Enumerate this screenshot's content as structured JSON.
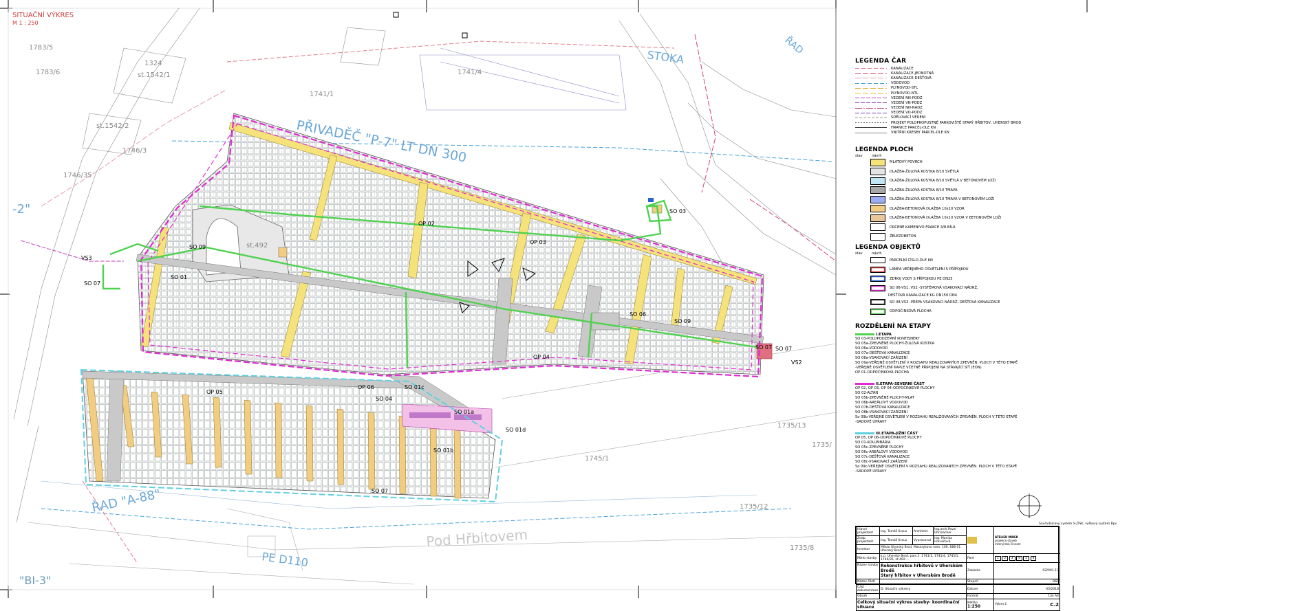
{
  "drawing": {
    "title": "SITUAČNÍ VÝKRES",
    "scale": "M 1 : 250"
  },
  "map_labels": {
    "privadec": "PŘIVADĚČ \"P-7\" LT DN 300",
    "pod_hrbitovem": "Pod Hřbitovem",
    "rad_a88": "ŘAD \"A-88\"",
    "stoka_bi3": "\"BI-3\"",
    "stoka": "STOKA",
    "rad": "ŘAD",
    "pe_label": "PE D110",
    "quote2": "-2\"",
    "parcels": [
      "1783/5",
      "1783/6",
      "st.1542/1",
      "st.1542/2",
      "1746/35",
      "1741/1",
      "1741/4",
      "st.492",
      "1745/1",
      "1735/13",
      "1735/12",
      "1735/8",
      "1735/",
      "1746/3",
      "1324"
    ],
    "objects": [
      "SO 09",
      "SO 01",
      "SO 07",
      "VS3",
      "OP 02",
      "OP 03",
      "SO 03",
      "SO 06",
      "SO 09",
      "SO 07",
      "SO 07",
      "VS2",
      "OP 04",
      "OP 05",
      "OP 06",
      "SO 04",
      "SO 01c",
      "SO 01a",
      "SO 01d",
      "SO 01b",
      "SO 07"
    ]
  },
  "legend_lines": {
    "title": "LEGENDA ČAR",
    "items": [
      {
        "label": "KANALIZACE",
        "color": "#e07a8a",
        "dash": "6,3"
      },
      {
        "label": "KANALIZACE-JEDNOTNÁ",
        "color": "#d2466a",
        "dash": "8,3"
      },
      {
        "label": "KANALIZACE-DEŠŤOVÁ",
        "color": "#e59aa8",
        "dash": "8,3"
      },
      {
        "label": "VODOVOD",
        "color": "#4aa3d8",
        "dash": "6,3"
      },
      {
        "label": "PLYNOVOD-STL",
        "color": "#e3a520",
        "dash": "8,3"
      },
      {
        "label": "PLYNOVOD-NTL",
        "color": "#d8c030",
        "dash": "8,3"
      },
      {
        "label": "VEDENÍ NN-PODZ",
        "color": "#c040c0",
        "dash": "6,2"
      },
      {
        "label": "VEDENÍ VN-PODZ",
        "color": "#8a3aa8",
        "dash": "6,2"
      },
      {
        "label": "VEDENÍ NN-NADZ",
        "color": "#b0306a",
        "dash": "10,2,2,2"
      },
      {
        "label": "VEDENÍ VO-PODZ",
        "color": "#7040c0",
        "dash": "6,2"
      },
      {
        "label": "SDĚLOVACÍ VEDENÍ",
        "color": "#909090",
        "dash": "4,2"
      },
      {
        "label": "PROJEKT POLOPROPUSTNÉ PARKOVIŠTĚ STARÝ HŘBITOV, UHERSKÝ BROD",
        "color": "#606060",
        "dash": "2,2"
      },
      {
        "label": "HRANICE PARCEL-DLE KN",
        "color": "#404040",
        "dash": "0"
      },
      {
        "label": "VNITŘNÍ KRESBY PARCEL-DLE KN",
        "color": "#808080",
        "dash": "0"
      }
    ]
  },
  "legend_areas": {
    "title": "LEGENDA PLOCH",
    "col_stav": "stav",
    "col_navrh": "návrh",
    "items": [
      {
        "label": "MLATOVÝ POVRCH",
        "color": "#f6e27a"
      },
      {
        "label": "DLAŽBA-ŽULOVÁ KOSTKA 8/10 SVĚTLÁ",
        "color": "#e4e4e4"
      },
      {
        "label": "DLAŽBA-ŽULOVÁ KOSTKA 8/10 SVĚTLÁ V BETONOVÉM LOŽI",
        "color": "#bfe6f2"
      },
      {
        "label": "DLAŽBA-ŽULOVÁ KOSTKA 8/10 TMAVÁ",
        "color": "#a8a8a8"
      },
      {
        "label": "DLAŽBA-ŽULOVÁ KOSTKA 8/10 TMAVÁ V BETONOVÉM LOŽI",
        "color": "#9cacf0"
      },
      {
        "label": "DLAŽBA-BETONOVÁ DLAŽBA 10x10 VZOR",
        "color": "#f2cc80"
      },
      {
        "label": "DLAŽBA-BETONOVÁ DLAŽBA 10x10 VZOR V BETONOVÉM LOŽI",
        "color": "#e9c79a"
      },
      {
        "label": "DRCENÉ KAMENIVO FRAKCE 4/8-BÍLÁ",
        "color": "#ffffff"
      },
      {
        "label": "ŽELEZOBETON",
        "color": "#ffffff"
      }
    ]
  },
  "legend_objects": {
    "title": "LEGENDA OBJEKTŮ",
    "col_stav": "stav",
    "col_navrh": "návrh",
    "items": [
      {
        "label": "PARCELNÍ ČÍSLO-DLE KN"
      },
      {
        "label": "LAMPA VEŘEJNÉHO OSVĚTLENÍ S PŘÍPOJKOU"
      },
      {
        "label": "ZDROJ VODY S PŘÍPOJKOU PE DN25"
      },
      {
        "label": "SO 08-VS1, VS2 -SYSTÉMOVÁ VSAKOVACÍ NÁDRŽ,"
      },
      {
        "label": "DEŠŤOVÁ KANALIZACE KG DN150 DN4"
      },
      {
        "label": "SO 08-VS3 -PŘEPA VSAKOVACÍ NÁDRŽ, DEŠŤOVÁ KANALIZACE"
      },
      {
        "label": "ODPOČINKOVÁ PLOCHA"
      }
    ]
  },
  "stages": {
    "title": "ROZDĚLENÍ NA ETAPY",
    "stage1": {
      "name": "I.ETAPA",
      "color": "#4fd24f",
      "lines": [
        "SO 03-POLOPODZEMNÍ KONTEJNERY",
        "SO 05a-ZPEVNĚNÉ PLOCHY-ŽULOVÁ KOSTKA",
        "SO 06a-VODOVOD",
        "SO 07a-DEŠŤOVÁ KANALIZACE",
        "SO 08a-VSAKOVACÍ ZAŘÍZENÍ",
        "SO 09a-VEŘEJNÉ OSVĚTLENÍ V ROZSAHU REALIZOVANÝCH ZPEVNĚN. PLOCH V TÉTO ETAPĚ",
        "-VEŘEJNÉ OSVĚTLENÍ KAPLE VČETNĚ PŘIPOJENÍ NA STÁVAJÍCÍ SÍŤ (EON)",
        "OP 01-ODPOČINKOVÁ PLOCHA"
      ]
    },
    "stage2": {
      "name": "II.ETAPA-SEVERNÍ ČÁST",
      "color": "#e02ad2",
      "lines": [
        "OP 02, OP 03, OP 04-ODPOČINKOVÉ PLOCHY",
        "SO 02-ALTÁN",
        "SO 05b-ZPEVNĚNÉ PLOCHY-MLAT",
        "SO 06b-AREÁLOVÝ VODOVOD",
        "SO 07b-DEŠŤOVÁ KANALIZACE",
        "SO 08b-VSAKOVACÍ ZAŘÍZENÍ",
        "So 09b-VEŘEJNÉ OSVĚTLENÍ V ROZSAHU REALIZOVANÝCH ZPEVNĚN. PLOCH V TÉTO ETAPĚ",
        "-SADOVÉ ÚPRAVY"
      ]
    },
    "stage3": {
      "name": "III.ETAPA-JIŽNÍ ČÁST",
      "color": "#5fd0e0",
      "lines": [
        "OP 05, OP 06-ODPOČINKOVÉ PLOCHY",
        "SO 01-KOLUMBÁRIA",
        "SO 05c-ZPEVNĚNÉ PLOCHY",
        "SO 06c-AREÁLOVÝ VODOVOD",
        "SO 07c-DEŠŤOVÁ KANALIZACE",
        "SO 08c-VSAKOVACÍ ZAŘÍZENÍ",
        "So 09c-VEŘEJNÉ OSVĚTLENÍ V ROZSAHU REALIZOVANÝCH ZPEVNĚN. PLOCH V TÉTO ETAPĚ",
        "-SADOVÉ ÚPRAVY"
      ]
    }
  },
  "coord_note": "Souřadnicový systém S-JTSK, výškový systém Bpv",
  "title_block": {
    "row1": [
      "Hlavní projektant",
      "Ing. Tomáš Kraus",
      "Architekt",
      "Ing.arch.Pavel Uhrmacher"
    ],
    "row2": [
      "Zodp. projektant",
      "Ing. Tomáš Kraus",
      "Vypracoval",
      "Ing. Monika Hlaváčová"
    ],
    "investor_label": "Investor",
    "investor": "Město Uherský Brod, Masarykovo nám. 100, 688 01 Uherský Brod",
    "place_label": "Místo stavby",
    "place": "k.ú. Uherský Brod, parc.č. 1741/1, 1741/4, 1745/1, 1746/35, st.492 ...",
    "stavba_label": "Název stavby",
    "stavba1": "Rekonstrukce hřbitovů v Uherském Brodě",
    "stavba2": "Starý hřbitov v Uherském Brodě",
    "cast_label": "Název části",
    "stupen_label": "Část dokumentace",
    "stupen": "D. Situační výkresy",
    "obsah_label": "Obsah",
    "obsah": "Celkový situační výkres stavby- koordinační situace",
    "meritko_label": "Měřítko",
    "meritko": "1:250",
    "vykres_label": "Výkres č.",
    "vykres": "C.2",
    "format_label": "Formát",
    "format": "13x A4",
    "datum_label": "Datum",
    "datum": "03/2018",
    "stupen_short_label": "Stupeň",
    "stupen_short": "DSP",
    "zakazka_label": "Zakázka",
    "zakazka": "RZ/001-17",
    "pare_label": "Paré",
    "pare_values": [
      "1",
      "2",
      "3",
      "4",
      "5",
      "6"
    ],
    "firm_lines": [
      "ATELIER MIREK",
      "projekce staveb",
      "inženýrská činnost"
    ]
  }
}
